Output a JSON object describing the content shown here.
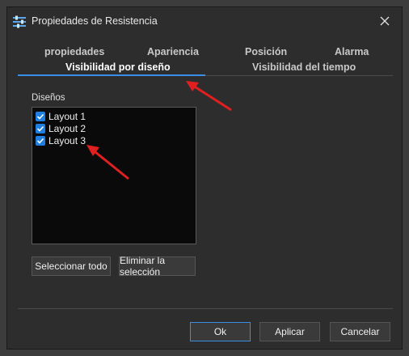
{
  "window": {
    "title": "Propiedades de Resistencia"
  },
  "tabs": {
    "row1": [
      "propiedades",
      "Apariencia",
      "Posición",
      "Alarma"
    ],
    "row2": [
      "Visibilidad por diseño",
      "Visibilidad del tiempo"
    ],
    "active": "Visibilidad por diseño"
  },
  "designs": {
    "label": "Diseños",
    "items": [
      {
        "label": "Layout 1",
        "checked": true
      },
      {
        "label": "Layout 2",
        "checked": true
      },
      {
        "label": "Layout 3",
        "checked": true
      }
    ],
    "select_all": "Seleccionar todo",
    "clear_selection": "Eliminar la selección"
  },
  "footer": {
    "ok": "Ok",
    "apply": "Aplicar",
    "cancel": "Cancelar"
  },
  "colors": {
    "accent": "#3a8ee6",
    "checkbox": "#1f7fe0",
    "annotation_arrow": "#e02020"
  }
}
